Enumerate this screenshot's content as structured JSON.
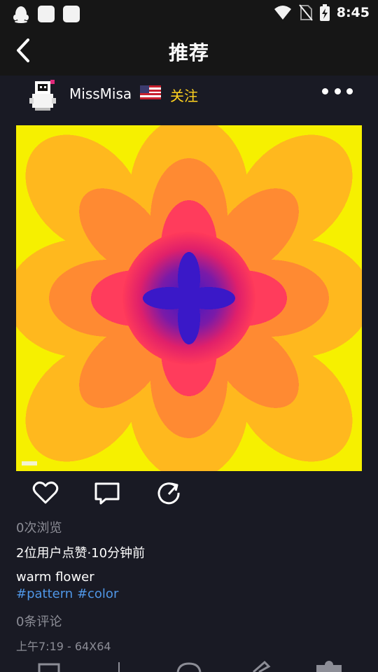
{
  "status_bar": {
    "time": "8:45"
  },
  "header": {
    "title": "推荐",
    "back_icon": "chevron-left-icon"
  },
  "post": {
    "username": "MissMisa",
    "country_flag": "us-flag-icon",
    "follow_label": "关注",
    "views_text": "0次浏览",
    "likes_text": "2位用户点赞·10分钟前",
    "title": "warm flower",
    "tags_text": "#pattern #color",
    "comments_text": "0条评论",
    "meta_text": "上午7:19 - 64X64"
  },
  "colors": {
    "background": "#191a24",
    "bar": "#161616",
    "follow": "#ffd21f",
    "tag_link": "#4f96e6",
    "muted_text": "#8c8d96"
  }
}
